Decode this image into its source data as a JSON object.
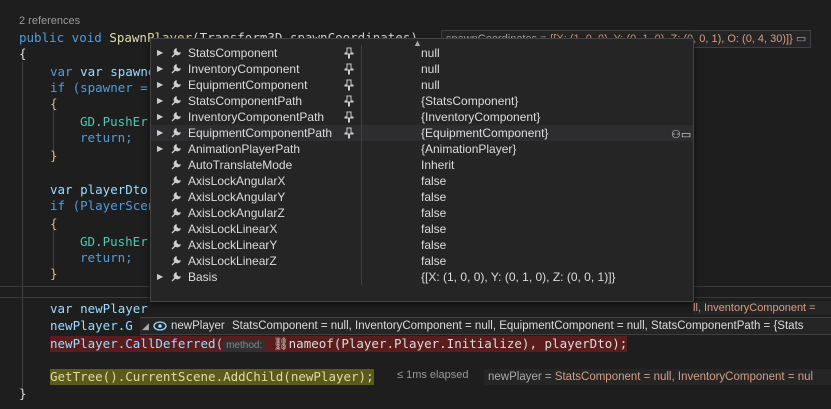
{
  "codelens": "2 references",
  "code": {
    "sig_public": "public void ",
    "sig_method": "SpawnPlayer",
    "sig_rest": "(Transform3D spawnCoordinates)",
    "brace_open": "{",
    "l_var_spawner": "var spawner = ",
    "l_if_spawner": "if (spawner = ",
    "l_brace2": "{",
    "l_gd_push1": "GD.PushEr",
    "l_return1": "return;",
    "l_brace3": "}",
    "l_var_dto": "var playerDto",
    "l_if_scene": "if (PlayerScen",
    "l_brace4": "{",
    "l_gd_push2": "GD.PushEr",
    "l_return2": "return;",
    "l_brace5": "}",
    "l_var_newplayer": "var newPlayer",
    "l_newplayer_g": "newPlayer.G",
    "l_calldeferred": "newPlayer.CallDeferred(",
    "l_hint": "method:",
    "l_nameof": "nameof(Player.Player.Initialize), playerDto);",
    "l_gettree": "GetTree().CurrentScene.AddChild(newPlayer);",
    "brace_close": "}"
  },
  "datatip_top": {
    "name": "spawnCoordinates = ",
    "value": "{[X: (1, 0, 0), Y: (0, 1, 0), Z: (0, 0, 1), O: (0, 4, 30)]}"
  },
  "popup": {
    "rows": [
      {
        "name": "StatsComponent",
        "value": "null",
        "expandable": true,
        "pinned": true
      },
      {
        "name": "InventoryComponent",
        "value": "null",
        "expandable": true,
        "pinned": true
      },
      {
        "name": "EquipmentComponent",
        "value": "null",
        "expandable": true,
        "pinned": true
      },
      {
        "name": "StatsComponentPath",
        "value": "{StatsComponent}",
        "expandable": true,
        "pinned": true
      },
      {
        "name": "InventoryComponentPath",
        "value": "{InventoryComponent}",
        "expandable": true,
        "pinned": true
      },
      {
        "name": "EquipmentComponentPath",
        "value": "{EquipmentComponent}",
        "expandable": true,
        "pinned": true
      },
      {
        "name": "AnimationPlayerPath",
        "value": "{AnimationPlayer}",
        "expandable": true,
        "pinned": false
      },
      {
        "name": "AutoTranslateMode",
        "value": "Inherit",
        "expandable": false,
        "pinned": false
      },
      {
        "name": "AxisLockAngularX",
        "value": "false",
        "expandable": false,
        "pinned": false
      },
      {
        "name": "AxisLockAngularY",
        "value": "false",
        "expandable": false,
        "pinned": false
      },
      {
        "name": "AxisLockAngularZ",
        "value": "false",
        "expandable": false,
        "pinned": false
      },
      {
        "name": "AxisLockLinearX",
        "value": "false",
        "expandable": false,
        "pinned": false
      },
      {
        "name": "AxisLockLinearY",
        "value": "false",
        "expandable": false,
        "pinned": false
      },
      {
        "name": "AxisLockLinearZ",
        "value": "false",
        "expandable": false,
        "pinned": false
      },
      {
        "name": "Basis",
        "value": "{[X: (1, 0, 0), Y: (0, 1, 0), Z: (0, 0, 1)]}",
        "expandable": true,
        "pinned": false
      }
    ]
  },
  "controller": {
    "name": "newPlayer",
    "summary": "StatsComponent = null, InventoryComponent = null, EquipmentComponent = null, StatsComponentPath = {Stats"
  },
  "right_tip": {
    "text": "ll, InventoryComponent = "
  },
  "perf": "≤ 1ms elapsed",
  "tip_bottom": {
    "name": "newPlayer = ",
    "value": "StatsComponent = null, InventoryComponent = nul"
  },
  "colors": {
    "keyword": "#569cd6",
    "method": "#dcdcaa",
    "type": "#4ec9b0",
    "identifier": "#9cdcfe",
    "breakpoint_bg": "#5a1d1d",
    "current_stmt_bg": "#5a5a1a"
  }
}
